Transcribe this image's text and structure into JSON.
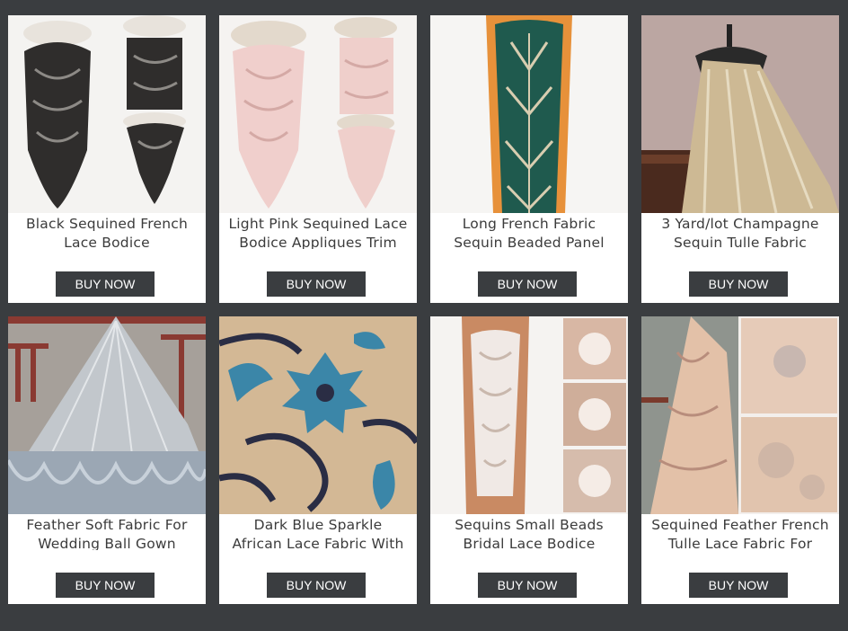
{
  "products": [
    {
      "title": "Black Sequined French Lace Bodice Embroidered Appliques",
      "button": "BUY NOW"
    },
    {
      "title": "Light Pink Sequined Lace Bodice Appliques Trim",
      "button": "BUY NOW"
    },
    {
      "title": "Long French Fabric Sequin Beaded Panel",
      "button": "BUY NOW"
    },
    {
      "title": "3 Yard/lot Champagne Sequin Tulle Fabric",
      "button": "BUY NOW"
    },
    {
      "title": "Feather Soft Fabric For Wedding Ball Gown",
      "button": "BUY NOW"
    },
    {
      "title": "Dark Blue Sparkle African Lace Fabric With Glitter",
      "button": "BUY NOW"
    },
    {
      "title": "Sequins Small Beads Bridal Lace Bodice Appliques",
      "button": "BUY NOW"
    },
    {
      "title": "Sequined Feather French Tulle Lace Fabric For Dress",
      "button": "BUY NOW"
    }
  ]
}
